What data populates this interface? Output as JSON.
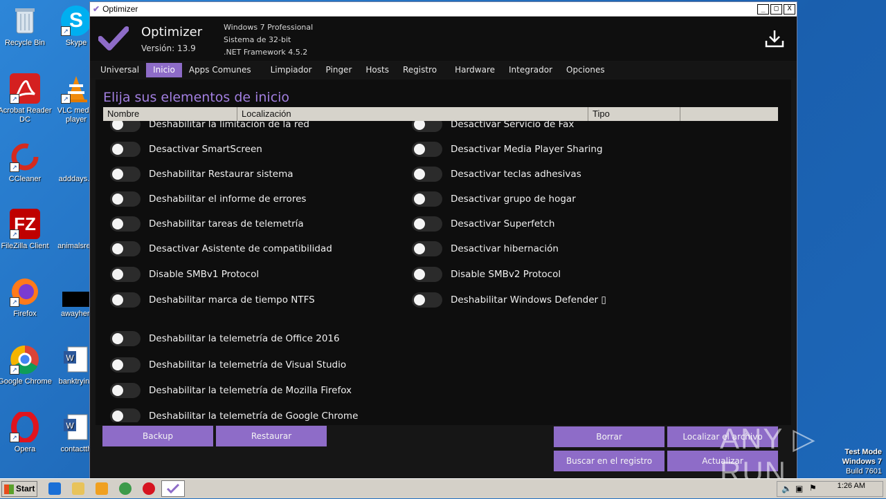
{
  "desktop_icons": [
    {
      "label": "Recycle Bin",
      "icon": "recycle-bin-icon"
    },
    {
      "label": "Skype",
      "icon": "skype-icon"
    },
    {
      "label": "Acrobat Reader DC",
      "icon": "acrobat-icon"
    },
    {
      "label": "VLC media player",
      "icon": "vlc-icon"
    },
    {
      "label": "CCleaner",
      "icon": "ccleaner-icon"
    },
    {
      "label": "adddays.p",
      "icon": "file-icon"
    },
    {
      "label": "FileZilla Client",
      "icon": "filezilla-icon"
    },
    {
      "label": "animalsreg",
      "icon": "file-icon"
    },
    {
      "label": "Firefox",
      "icon": "firefox-icon"
    },
    {
      "label": "awayher.",
      "icon": "file-icon"
    },
    {
      "label": "Google Chrome",
      "icon": "chrome-icon"
    },
    {
      "label": "banktrying",
      "icon": "word-doc-icon"
    },
    {
      "label": "Opera",
      "icon": "opera-icon"
    },
    {
      "label": "contactth",
      "icon": "word-doc-icon"
    }
  ],
  "window": {
    "title": "Optimizer",
    "minimize": "_",
    "maximize": "□",
    "close": "X"
  },
  "header": {
    "app_name": "Optimizer",
    "version": "Versión: 13.9",
    "os": "Windows 7 Professional",
    "arch": "Sistema de 32-bit",
    "framework": ".NET Framework 4.5.2"
  },
  "tabs": [
    {
      "label": "Universal",
      "active": false
    },
    {
      "label": "Inicio",
      "active": true
    },
    {
      "label": "Apps Comunes",
      "active": false
    },
    {
      "label": "Limpiador",
      "active": false
    },
    {
      "label": "Pinger",
      "active": false
    },
    {
      "label": "Hosts",
      "active": false
    },
    {
      "label": "Registro",
      "active": false
    },
    {
      "label": "Hardware",
      "active": false
    },
    {
      "label": "Integrador",
      "active": false
    },
    {
      "label": "Opciones",
      "active": false
    }
  ],
  "content": {
    "title": "Elija sus elementos de inicio",
    "columns": [
      "Nombre",
      "Localización",
      "Tipo",
      ""
    ]
  },
  "toggles_left": [
    {
      "label": "Deshabilitar la limitación de la red",
      "on": false
    },
    {
      "label": "Desactivar SmartScreen",
      "on": false
    },
    {
      "label": "Deshabilitar Restaurar sistema",
      "on": false
    },
    {
      "label": "Deshabilitar el informe de errores",
      "on": false
    },
    {
      "label": "Deshabilitar tareas de telemetría",
      "on": false
    },
    {
      "label": "Desactivar Asistente de compatibilidad",
      "on": false
    },
    {
      "label": "Disable SMBv1 Protocol",
      "on": false
    },
    {
      "label": "Deshabilitar marca de tiempo NTFS",
      "on": false
    },
    {
      "label": "Deshabilitar la telemetría de Office 2016",
      "on": false
    },
    {
      "label": "Deshabilitar la telemetría de Visual Studio",
      "on": false
    },
    {
      "label": "Deshabilitar la telemetría de Mozilla Firefox",
      "on": false
    },
    {
      "label": "Deshabilitar la telemetría de Google Chrome",
      "on": false
    }
  ],
  "toggles_right": [
    {
      "label": "Desactivar Servicio de Fax",
      "on": false
    },
    {
      "label": "Desactivar Media Player Sharing",
      "on": false
    },
    {
      "label": "Desactivar teclas adhesivas",
      "on": false
    },
    {
      "label": "Desactivar grupo de hogar",
      "on": false
    },
    {
      "label": "Desactivar Superfetch",
      "on": false
    },
    {
      "label": "Desactivar hibernación",
      "on": false
    },
    {
      "label": "Disable SMBv2 Protocol",
      "on": false
    },
    {
      "label": "Deshabilitar Windows Defender ▯",
      "on": false
    }
  ],
  "buttons": {
    "backup": "Backup",
    "restore": "Restaurar",
    "delete": "Borrar",
    "locate_file": "Localizar el archivo",
    "search_registry": "Buscar en el registro",
    "refresh": "Actualizar"
  },
  "watermark": "ANY ▷ RUN",
  "test_mode": {
    "line1": "Test Mode",
    "line2": "Windows 7",
    "line3": "Build 7601"
  },
  "taskbar": {
    "start_label": "Start",
    "clock": "1:26 AM"
  },
  "colors": {
    "accent": "#8e6cc8",
    "title_purple": "#a27fe0",
    "background": "#161616",
    "desktop": "#1f6fc2"
  }
}
